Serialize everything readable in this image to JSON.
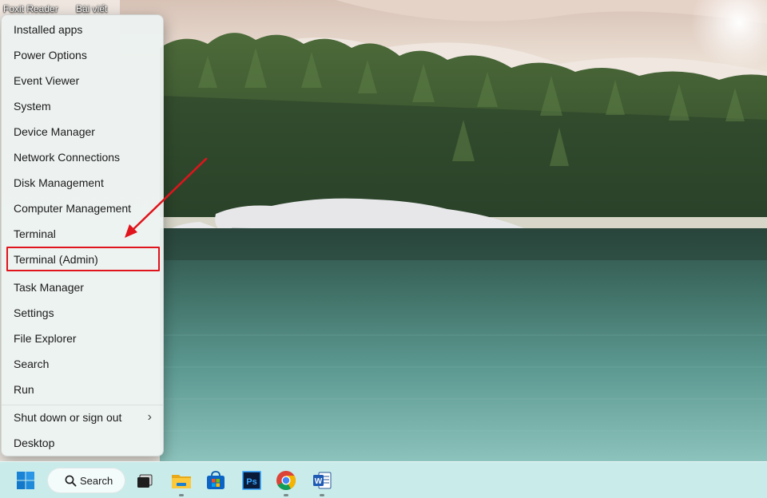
{
  "desktop": {
    "icon_labels": [
      "Foxit Reader",
      "Bài viết"
    ]
  },
  "quick_link_menu": {
    "items": [
      {
        "label": "Installed apps"
      },
      {
        "label": "Power Options"
      },
      {
        "label": "Event Viewer"
      },
      {
        "label": "System"
      },
      {
        "label": "Device Manager"
      },
      {
        "label": "Network Connections"
      },
      {
        "label": "Disk Management"
      },
      {
        "label": "Computer Management"
      },
      {
        "label": "Terminal"
      },
      {
        "label": "Terminal (Admin)",
        "highlighted": true
      },
      {
        "label": "Task Manager"
      },
      {
        "label": "Settings"
      },
      {
        "label": "File Explorer"
      },
      {
        "label": "Search"
      },
      {
        "label": "Run"
      },
      {
        "label": "Shut down or sign out",
        "has_submenu": true
      },
      {
        "label": "Desktop"
      }
    ],
    "submenu_glyph": "›",
    "highlight_color": "#e0141c"
  },
  "taskbar": {
    "search_label": "Search",
    "apps": [
      {
        "icon": "windows-start-icon"
      },
      {
        "icon": "search-icon"
      },
      {
        "icon": "task-view-icon"
      },
      {
        "icon": "file-explorer-icon",
        "running": true
      },
      {
        "icon": "microsoft-store-icon"
      },
      {
        "icon": "photoshop-icon",
        "text": "Ps"
      },
      {
        "icon": "chrome-icon",
        "running": true
      },
      {
        "icon": "word-icon",
        "text": "W",
        "running": true
      }
    ],
    "background": "#c9ecea"
  }
}
